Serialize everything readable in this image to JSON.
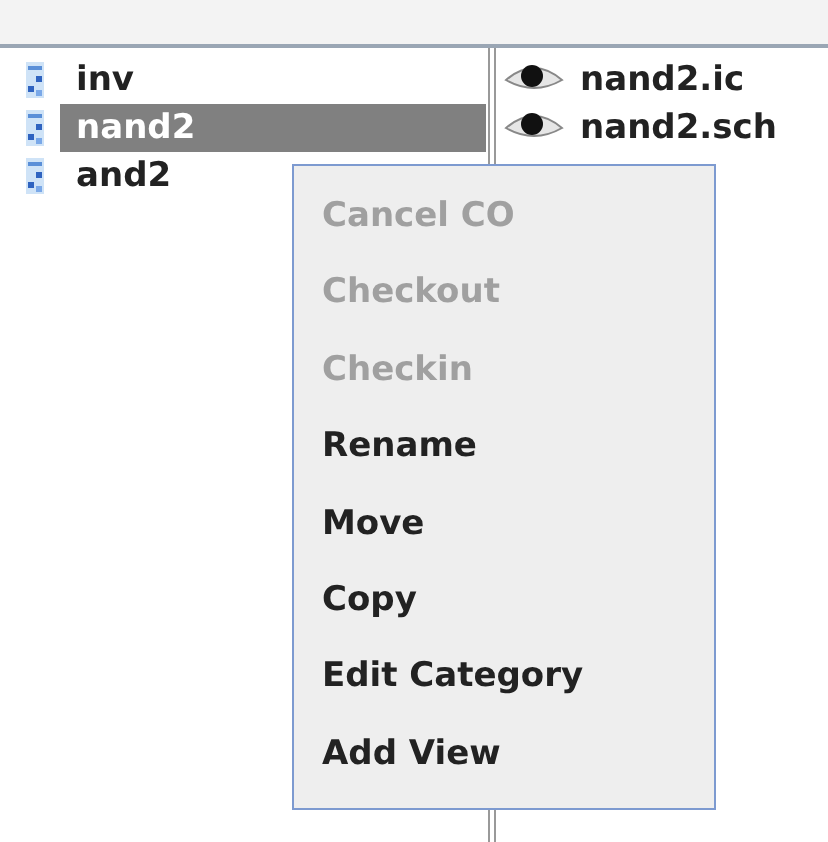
{
  "cells": [
    {
      "name": "inv",
      "selected": false
    },
    {
      "name": "nand2",
      "selected": true
    },
    {
      "name": "and2",
      "selected": false
    }
  ],
  "views": [
    {
      "name": "nand2.ic"
    },
    {
      "name": "nand2.sch"
    }
  ],
  "context_menu": {
    "items": [
      {
        "label": "Cancel CO",
        "disabled": true
      },
      {
        "label": "Checkout",
        "disabled": true
      },
      {
        "label": "Checkin",
        "disabled": true
      },
      {
        "label": "Rename",
        "disabled": false
      },
      {
        "label": "Move",
        "disabled": false
      },
      {
        "label": "Copy",
        "disabled": false
      },
      {
        "label": "Edit Category",
        "disabled": false
      },
      {
        "label": "Add View",
        "disabled": false
      }
    ]
  }
}
